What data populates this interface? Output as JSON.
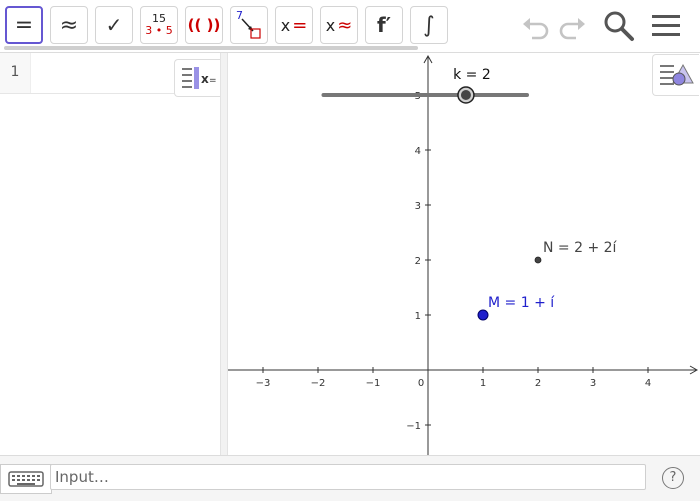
{
  "toolbar": {
    "tools": [
      {
        "name": "evaluate",
        "label": "="
      },
      {
        "name": "numeric",
        "label": "≈"
      },
      {
        "name": "check",
        "label": "✓"
      },
      {
        "name": "factor",
        "top": "15",
        "bottom": "3 • 5"
      },
      {
        "name": "expand",
        "label": "(( ))"
      },
      {
        "name": "substitute",
        "label": "7"
      },
      {
        "name": "solve",
        "label": "x",
        "suffix": "="
      },
      {
        "name": "nsolve",
        "label": "x",
        "suffix": "≈"
      },
      {
        "name": "derivative",
        "label": "f′"
      },
      {
        "name": "integral",
        "label": "∫"
      }
    ],
    "icons": [
      "undo-icon",
      "redo-icon",
      "search-icon",
      "menu-icon"
    ]
  },
  "algebra": {
    "row_number": "1"
  },
  "graphics": {
    "slider": {
      "label": "k = 2",
      "value": 2,
      "min": -5,
      "max": 5,
      "x_start": -1.9,
      "x_end": 1.8,
      "y": 5
    },
    "points": [
      {
        "id": "N",
        "label": "N = 2 + 2í",
        "x": 2,
        "y": 2,
        "color": "#444444"
      },
      {
        "id": "M",
        "label": "M = 1 + í",
        "x": 1,
        "y": 1,
        "color": "#1f1fcc"
      }
    ],
    "x_ticks": [
      "−3",
      "−2",
      "−1",
      "0",
      "1",
      "2",
      "3",
      "4"
    ],
    "y_ticks": [
      "5",
      "4",
      "3",
      "2",
      "1",
      "−1"
    ]
  },
  "input_bar": {
    "placeholder": "Input…",
    "help": "?"
  },
  "colors": {
    "accent": "#6557d2",
    "point_m": "#1f1fcc",
    "red": "#cc0000"
  }
}
